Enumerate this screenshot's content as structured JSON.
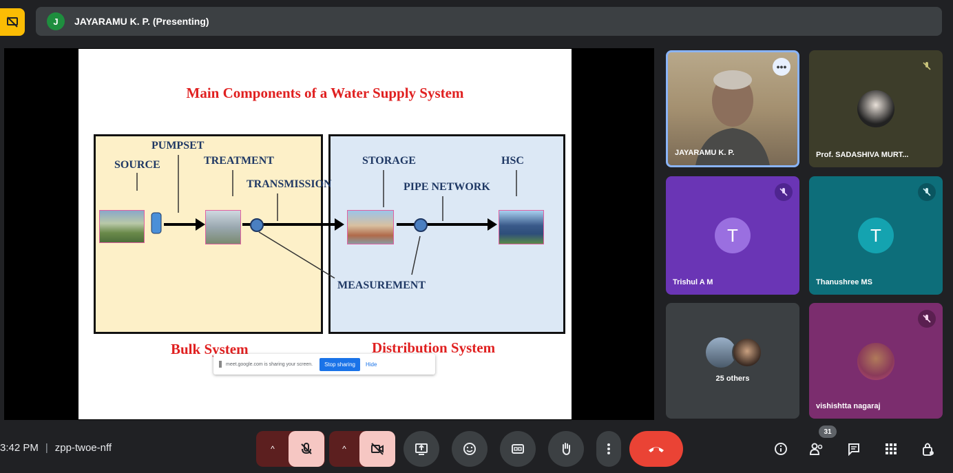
{
  "header": {
    "presenter_initial": "J",
    "presenter_label": "JAYARAMU K. P. (Presenting)"
  },
  "slide": {
    "title": "Main Components of a Water Supply System",
    "labels": {
      "pumpset": "PUMPSET",
      "source": "SOURCE",
      "treatment": "TREATMENT",
      "transmission": "TRANSMISSION",
      "storage": "STORAGE",
      "hsc": "HSC",
      "pipe_network": "PIPE NETWORK",
      "measurement": "MEASUREMENT"
    },
    "bulk_label": "Bulk System",
    "dist_label": "Distribution System"
  },
  "share_popup": {
    "message": "meet.google.com is sharing your screen.",
    "stop_label": "Stop sharing",
    "hide_label": "Hide"
  },
  "participants": [
    {
      "name": "JAYARAMU K. P."
    },
    {
      "name": "Prof. SADASHIVA MURT..."
    },
    {
      "name": "Trishul A M",
      "initial": "T"
    },
    {
      "name": "Thanushree MS",
      "initial": "T"
    },
    {
      "name": "25 others"
    },
    {
      "name": "vishishtta nagaraj"
    }
  ],
  "bottom": {
    "time": "3:42 PM",
    "meeting_code": "zpp-twoe-nff",
    "people_count": "31"
  },
  "colors": {
    "accent_blue": "#1a73e8",
    "end_call_red": "#ea4335",
    "presenting_yellow": "#fbbc04",
    "tile_purple": "#6a35b5",
    "tile_teal": "#0d6e7a",
    "tile_pink": "#7b2d6e"
  }
}
